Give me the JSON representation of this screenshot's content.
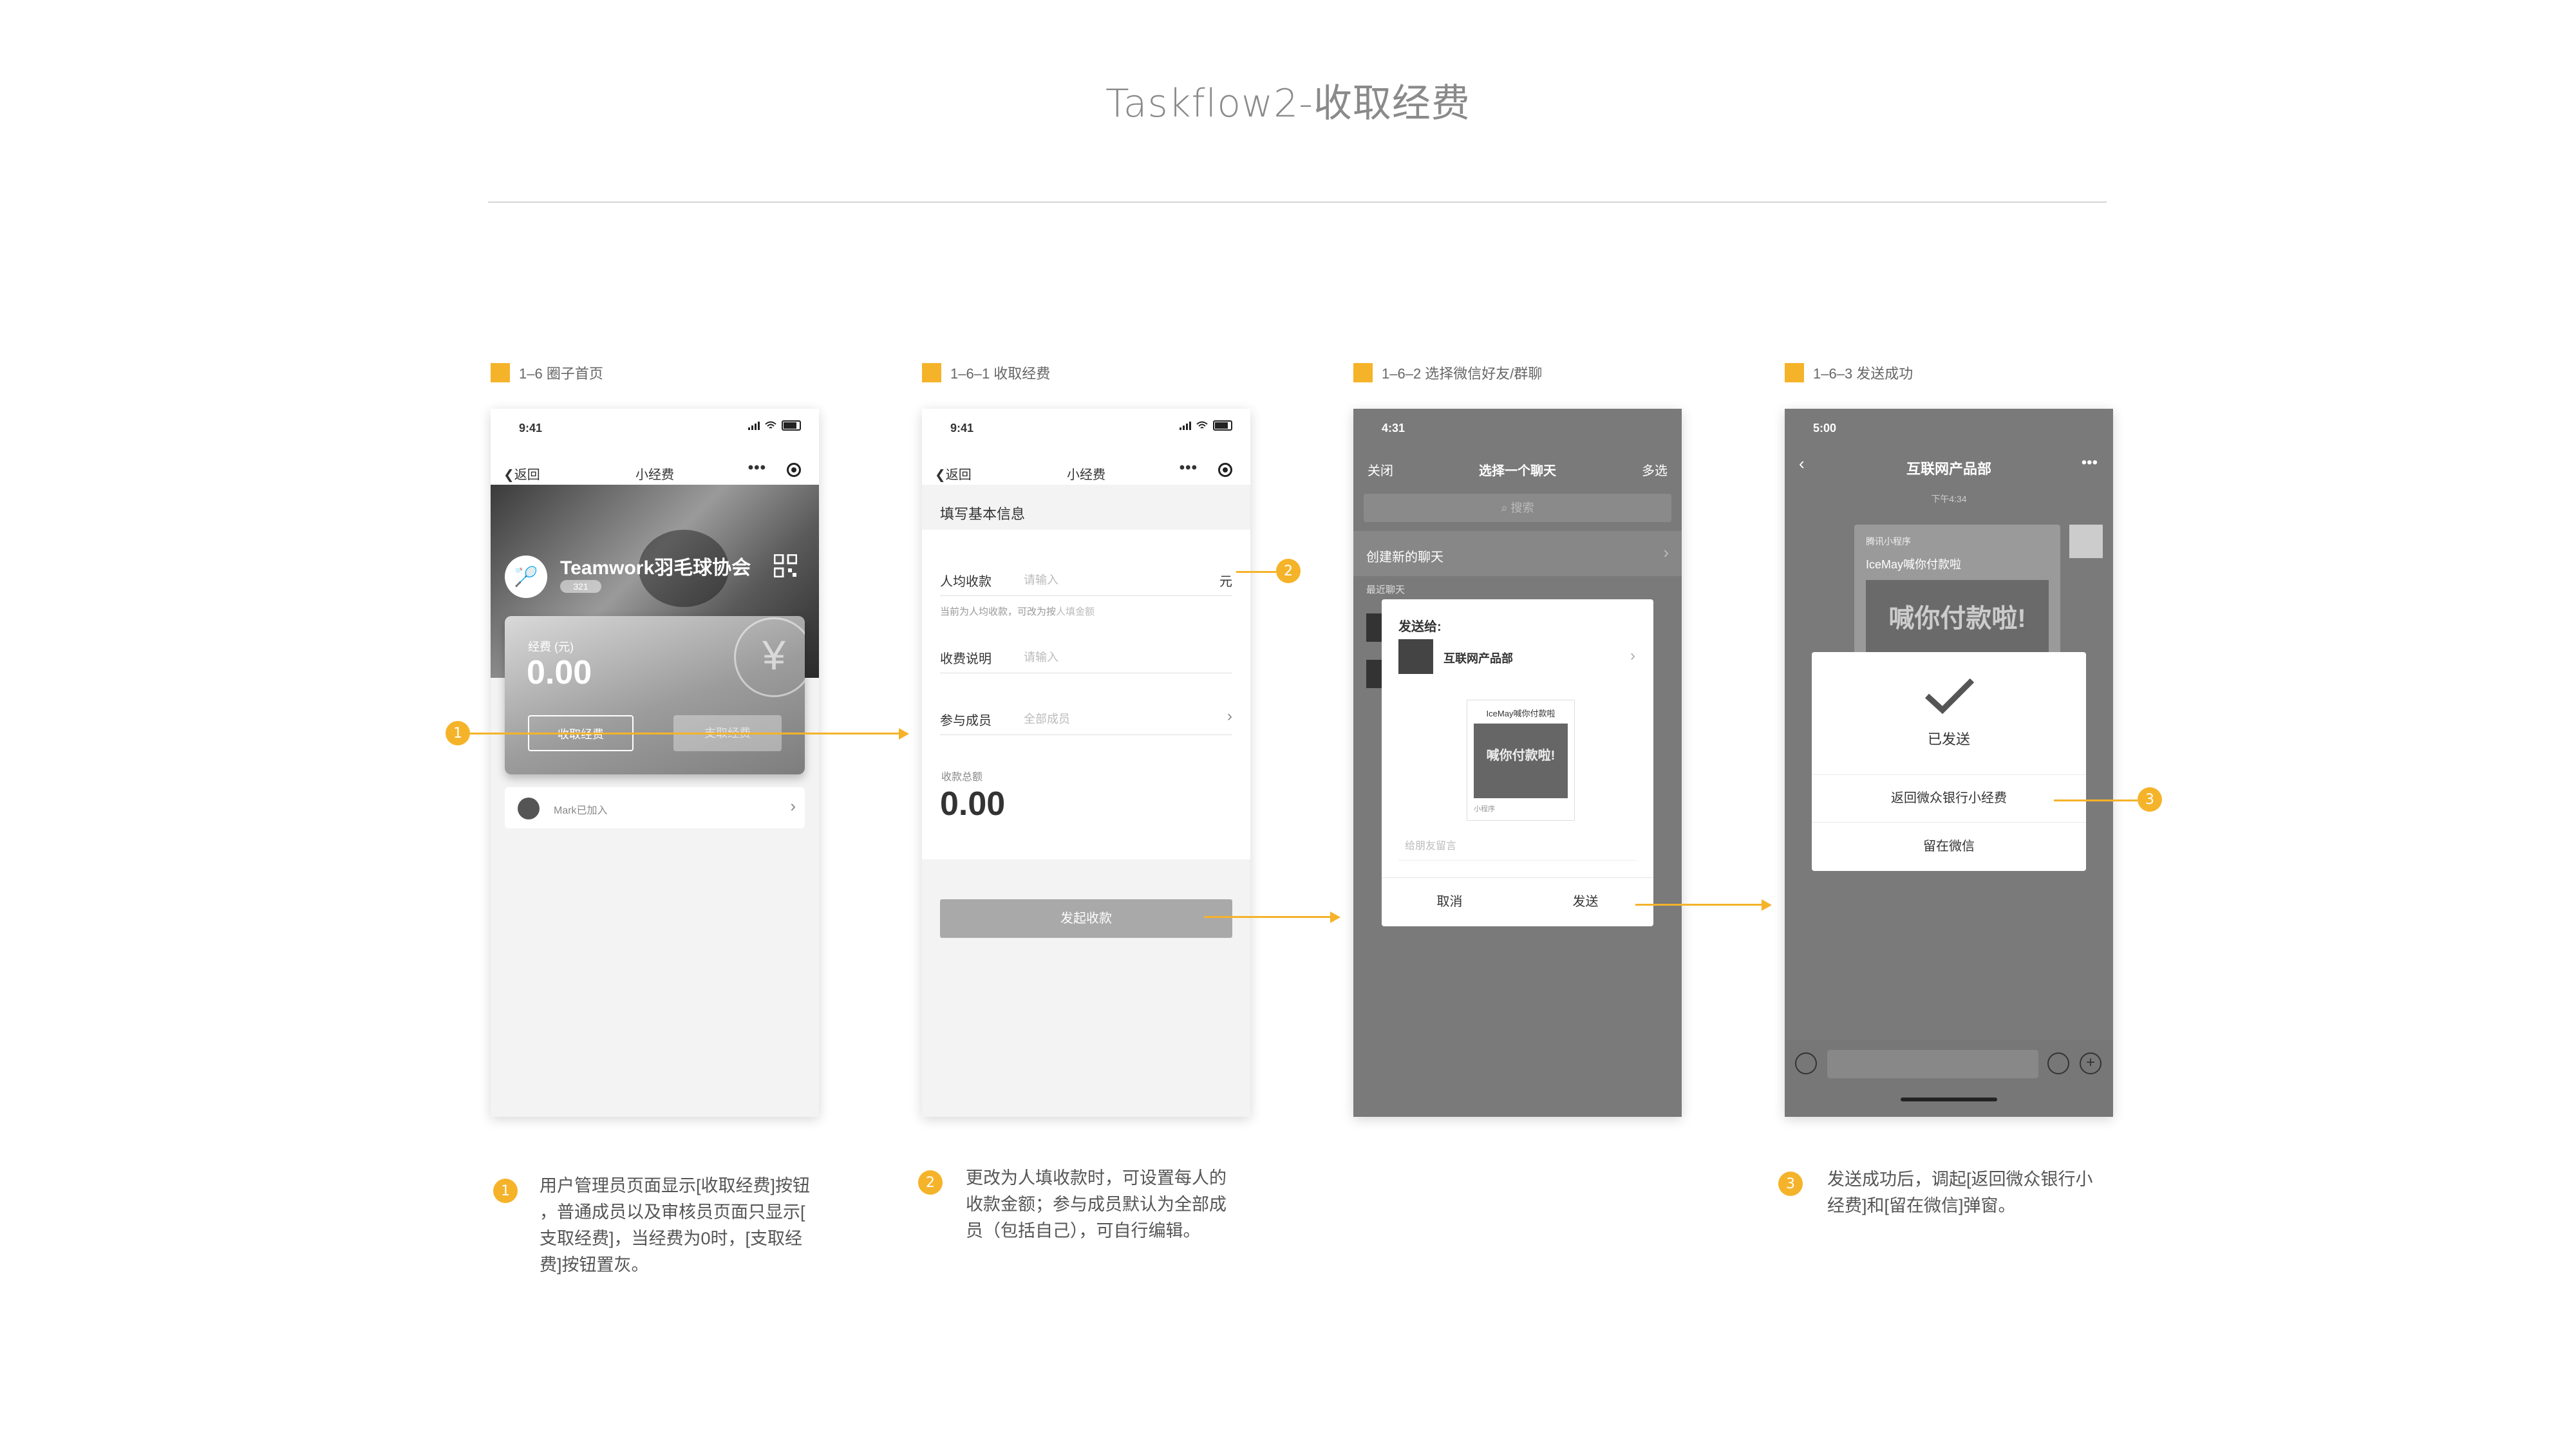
{
  "page_title": "Taskflow2-收取经费",
  "colors": {
    "accent": "#f5b32a"
  },
  "steps": [
    {
      "label": "1–6 圈子首页"
    },
    {
      "label": "1–6–1 收取经费"
    },
    {
      "label": "1–6–2 选择微信好友/群聊"
    },
    {
      "label": "1–6–3 发送成功"
    }
  ],
  "screen1": {
    "time": "9:41",
    "back": "返回",
    "nav_title": "小经费",
    "more": "•••",
    "club_name": "Teamwork羽毛球协会",
    "club_tag": "321",
    "fund_label": "经费 (元)",
    "fund_value": "0.00",
    "collect_button": "收取经费",
    "pay_button": "支取经费",
    "member_text": "Mark已加入",
    "yen_icon": "¥"
  },
  "screen2": {
    "time": "9:41",
    "back": "返回",
    "nav_title": "小经费",
    "more": "•••",
    "section_title": "填写基本信息",
    "per_person_label": "人均收款",
    "per_person_placeholder": "请输入",
    "unit": "元",
    "hint_prefix": "当前为人均收款，可改为按",
    "hint_link": "人填金额",
    "desc_label": "收费说明",
    "desc_placeholder": "请输入",
    "members_label": "参与成员",
    "members_placeholder": "全部成员",
    "total_label": "收款总额",
    "total_value": "0.00",
    "submit_button": "发起收款"
  },
  "screen3": {
    "time": "4:31",
    "close": "关闭",
    "nav_title": "选择一个聊天",
    "multi": "多选",
    "search": "搜索",
    "new_chat": "创建新的聊天",
    "recent": "最近聊天",
    "send_to": "发送给:",
    "group_name": "互联网产品部",
    "card_title": "IceMay喊你付款啦",
    "card_banner": "喊你付款啦!",
    "card_source": "小程序",
    "message_placeholder": "给朋友留言",
    "cancel": "取消",
    "send": "发送"
  },
  "screen4": {
    "time": "5:00",
    "nav_title": "互联网产品部",
    "more": "•••",
    "timestamp": "下午4:34",
    "msg_source": "腾讯小程序",
    "msg_title": "IceMay喊你付款啦",
    "msg_banner": "喊你付款啦!",
    "sent_text": "已发送",
    "return_button": "返回微众银行小经费",
    "stay_button": "留在微信"
  },
  "badges": [
    "1",
    "2",
    "3"
  ],
  "notes": {
    "note1": [
      "用户管理员页面显示[收取经费]按钮",
      "，普通成员以及审核员页面只显示[",
      "支取经费]，当经费为0时，[支取经",
      "费]按钮置灰。"
    ],
    "note2": [
      "更改为人填收款时，可设置每人的",
      "收款金额；参与成员默认为全部成",
      "员（包括自己），可自行编辑。"
    ],
    "note3": [
      "发送成功后，调起[返回微众银行小",
      "经费]和[留在微信]弹窗。"
    ]
  }
}
